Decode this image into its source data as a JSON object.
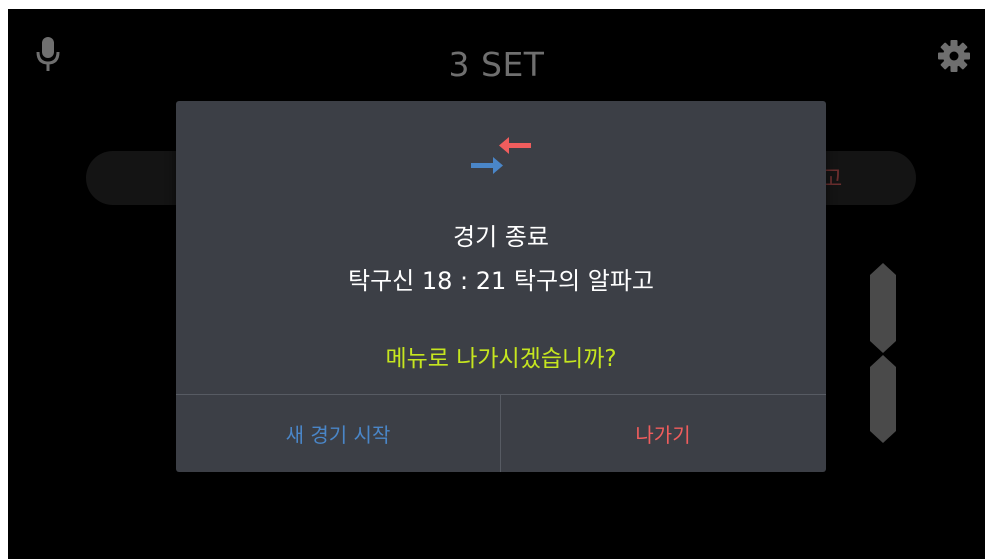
{
  "background": {
    "set_label": "3 SET",
    "pill_text": "고",
    "mic_icon": "mic-icon",
    "settings_icon": "gear-icon"
  },
  "dialog": {
    "icon": "swap-arrows-icon",
    "title": "경기 종료",
    "score_line": "탁구신 18 : 21 탁구의 알파고",
    "question": "메뉴로 나가시겠습니까?",
    "new_game_label": "새 경기 시작",
    "exit_label": "나가기"
  },
  "colors": {
    "dialog_bg": "#3c3f46",
    "question": "#c6e61f",
    "new_game": "#4a86c8",
    "exit": "#f05d5d",
    "arrow_blue": "#4a86c8",
    "arrow_red": "#f05d5d"
  }
}
